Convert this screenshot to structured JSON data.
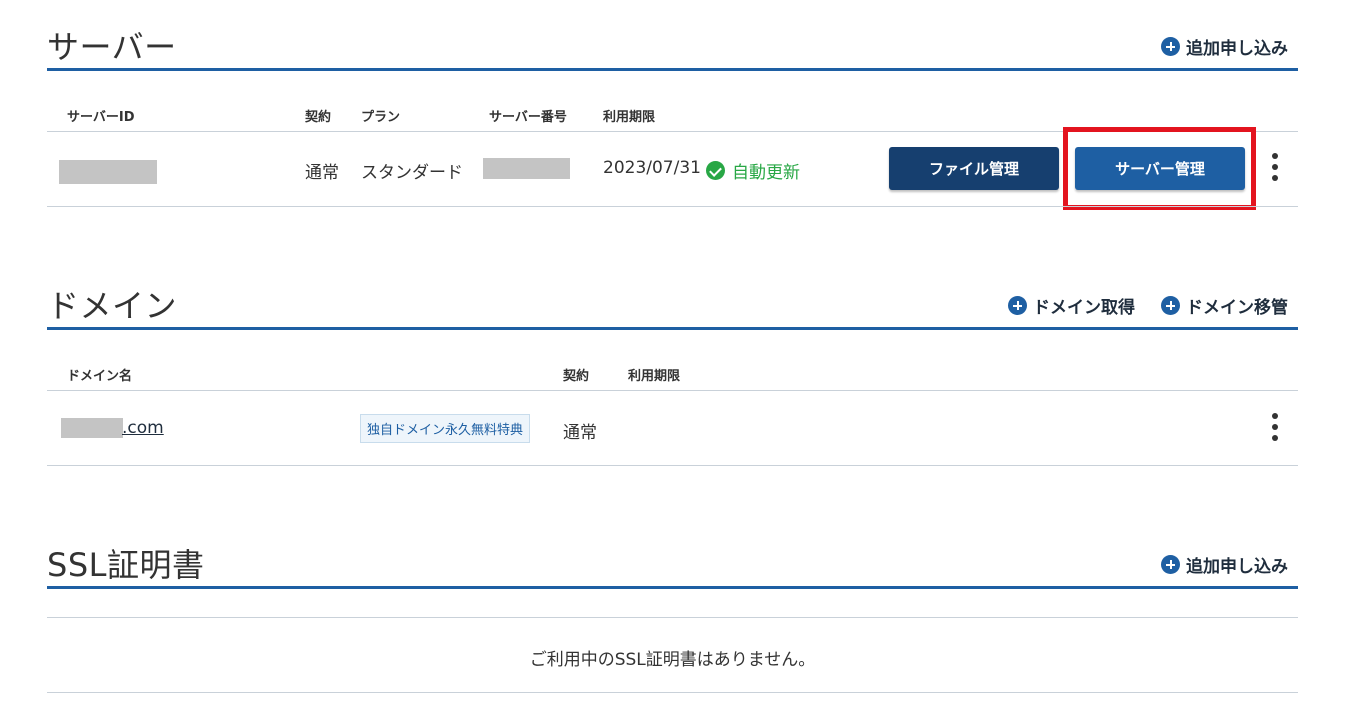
{
  "server": {
    "title": "サーバー",
    "add_label": "追加申し込み",
    "columns": {
      "id": "サーバーID",
      "contract": "契約",
      "plan": "プラン",
      "number": "サーバー番号",
      "expiry": "利用期限"
    },
    "row": {
      "contract": "通常",
      "plan": "スタンダード",
      "expiry": "2023/07/31",
      "status": "自動更新",
      "file_button": "ファイル管理",
      "server_button": "サーバー管理"
    }
  },
  "domain": {
    "title": "ドメイン",
    "acquire_label": "ドメイン取得",
    "transfer_label": "ドメイン移管",
    "columns": {
      "name": "ドメイン名",
      "contract": "契約",
      "expiry": "利用期限"
    },
    "row": {
      "name_suffix": ".com",
      "tag": "独自ドメイン永久無料特典",
      "contract": "通常"
    }
  },
  "ssl": {
    "title": "SSL証明書",
    "add_label": "追加申し込み",
    "empty_message": "ご利用中のSSL証明書はありません。"
  },
  "colors": {
    "accent": "#1e5fa3",
    "dark_button": "#163f6f",
    "success": "#28a745",
    "highlight": "#e3141f"
  },
  "icons": {
    "add": "plus-circle-icon",
    "status": "check-circle-icon",
    "menu": "kebab-menu-icon"
  }
}
